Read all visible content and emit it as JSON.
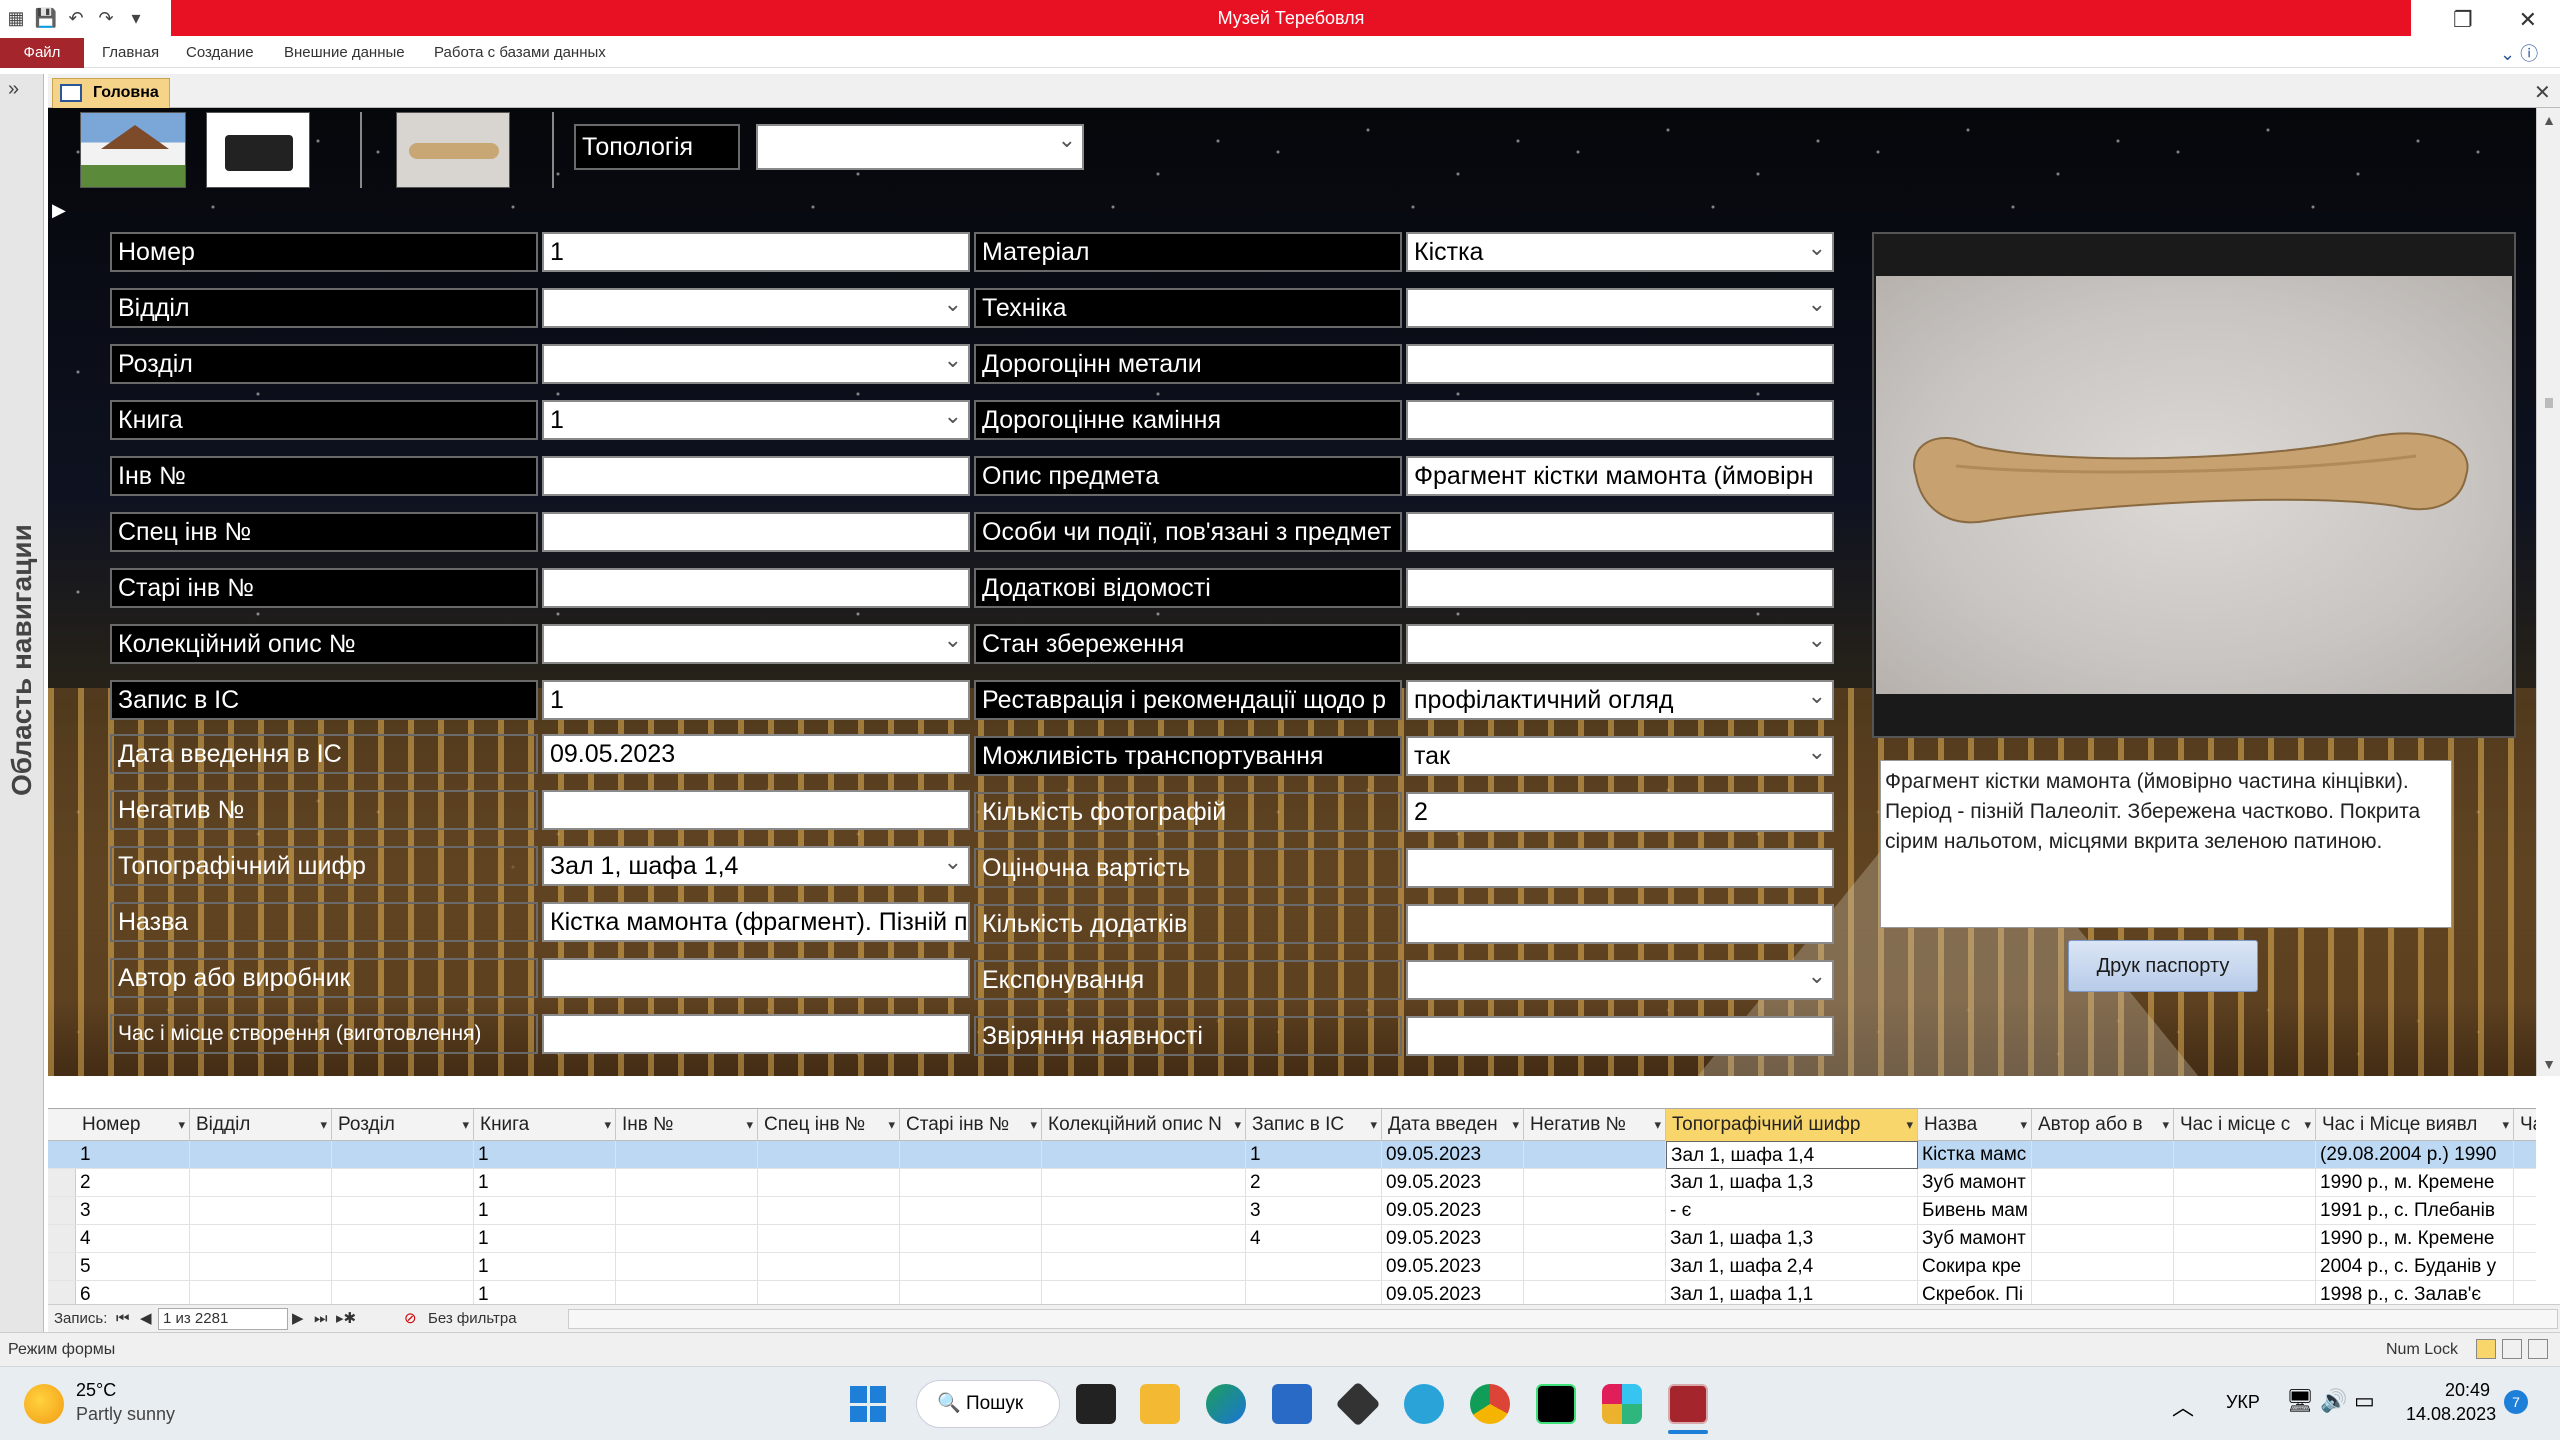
{
  "app_title": "Музей Теребовля",
  "ribbon": {
    "file": "Файл",
    "tabs": [
      "Главная",
      "Создание",
      "Внешние данные",
      "Работа с базами данных"
    ]
  },
  "nav_pane_label": "Область навигации",
  "doc_tab": "Головна",
  "top": {
    "topology_label": "Топологія",
    "topology_value": ""
  },
  "left_fields": [
    {
      "label": "Номер",
      "value": "1"
    },
    {
      "label": "Відділ",
      "value": ""
    },
    {
      "label": "Розділ",
      "value": ""
    },
    {
      "label": "Книга",
      "value": "1"
    },
    {
      "label": "Інв №",
      "value": ""
    },
    {
      "label": "Спец інв №",
      "value": ""
    },
    {
      "label": "Старі інв №",
      "value": ""
    },
    {
      "label": "Колекційний опис №",
      "value": ""
    },
    {
      "label": "Запис в ІС",
      "value": "1"
    },
    {
      "label": "Дата введення в ІС",
      "value": "09.05.2023"
    },
    {
      "label": "Негатив №",
      "value": ""
    },
    {
      "label": "Топографічний шифр",
      "value": "Зал 1, шафа 1,4"
    },
    {
      "label": "Назва",
      "value": "Кістка мамонта (фрагмент). Пізній п"
    },
    {
      "label": "Автор або виробник",
      "value": ""
    },
    {
      "label": "Час і місце створення (виготовлення)",
      "value": ""
    }
  ],
  "right_fields": [
    {
      "label": "Матеріал",
      "value": "Кістка"
    },
    {
      "label": "Техніка",
      "value": ""
    },
    {
      "label": "Дорогоцінн метали",
      "value": ""
    },
    {
      "label": "Дорогоцінне каміння",
      "value": ""
    },
    {
      "label": "Опис предмета",
      "value": "Фрагмент кістки мамонта (ймовірн"
    },
    {
      "label": "Особи чи події, пов'язані з предмет",
      "value": ""
    },
    {
      "label": "Додаткові відомості",
      "value": ""
    },
    {
      "label": "Стан збереження",
      "value": ""
    },
    {
      "label": "Реставрація і рекомендації щодо р",
      "value": "профілактичний огляд"
    },
    {
      "label": "Можливість транспортування",
      "value": "так"
    },
    {
      "label": "Кількість фотографій",
      "value": "2"
    },
    {
      "label": "Оціночна вартість",
      "value": ""
    },
    {
      "label": "Кількість додатків",
      "value": ""
    },
    {
      "label": "Експонування",
      "value": ""
    },
    {
      "label": "Звіряння наявності",
      "value": ""
    }
  ],
  "description": "Фрагмент кістки мамонта (ймовірно частина кінцівки). Період - пізній Палеоліт. Збережена частково. Покрита сірим нальотом, місцями вкрита зеленою патиною.",
  "print_button": "Друк паспорту",
  "datasheet": {
    "columns": [
      "Номер",
      "Відділ",
      "Розділ",
      "Книга",
      "Інв №",
      "Спец інв №",
      "Старі інв №",
      "Колекційний опис N",
      "Запис в ІС",
      "Дата введен",
      "Негатив №",
      "Топографічний шифр",
      "Назва",
      "Автор або в",
      "Час і місце с",
      "Час і Місце виявл",
      "Ча"
    ],
    "rows": [
      [
        "1",
        "",
        "",
        "1",
        "",
        "",
        "",
        "",
        "1",
        "09.05.2023",
        "",
        "Зал 1, шафа 1,4",
        "Кістка мамс",
        "",
        "",
        "(29.08.2004 р.) 1990",
        ""
      ],
      [
        "2",
        "",
        "",
        "1",
        "",
        "",
        "",
        "",
        "2",
        "09.05.2023",
        "",
        "Зал 1, шафа 1,3",
        "Зуб мамонт",
        "",
        "",
        "1990 р., м. Кременe",
        ""
      ],
      [
        "3",
        "",
        "",
        "1",
        "",
        "",
        "",
        "",
        "3",
        "09.05.2023",
        "",
        "- є",
        "Бивень мам",
        "",
        "",
        "1991 р., с. Плебанів",
        ""
      ],
      [
        "4",
        "",
        "",
        "1",
        "",
        "",
        "",
        "",
        "4",
        "09.05.2023",
        "",
        "Зал 1, шафа 1,3",
        "Зуб мамонт",
        "",
        "",
        "1990 р., м. Кременe",
        ""
      ],
      [
        "5",
        "",
        "",
        "1",
        "",
        "",
        "",
        "",
        "",
        "09.05.2023",
        "",
        "Зал 1, шафа 2,4",
        "Сокира кре",
        "",
        "",
        "2004 р., с. Буданів у",
        ""
      ],
      [
        "6",
        "",
        "",
        "1",
        "",
        "",
        "",
        "",
        "",
        "09.05.2023",
        "",
        "Зал 1, шафа 1,1",
        "Скребок. Пі",
        "",
        "",
        "1998 р., с. Залав'є",
        ""
      ]
    ]
  },
  "record_nav": {
    "label": "Запись:",
    "position": "1 из 2281",
    "filter": "Без фильтра"
  },
  "status": {
    "mode": "Режим формы",
    "numlock": "Num Lock"
  },
  "taskbar": {
    "temp": "25°C",
    "weather": "Partly sunny",
    "search": "Пошук",
    "lang": "УКР",
    "time": "20:49",
    "date": "14.08.2023",
    "badge": "7"
  }
}
